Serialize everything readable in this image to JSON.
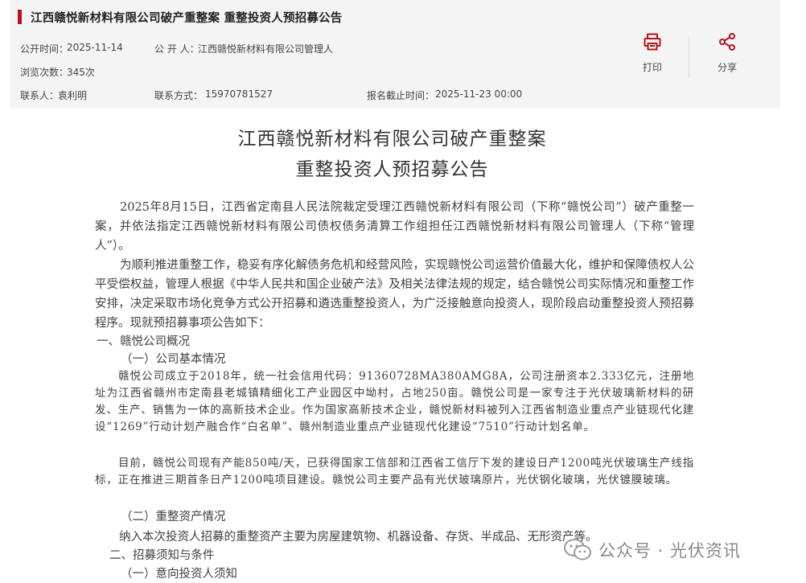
{
  "header": {
    "title": "江西赣悦新材料有限公司破产重整案 重整投资人预招募公告",
    "publish_time_label": "公开时间：",
    "publish_time": "2025-11-14",
    "publisher_label": "公 开 人：",
    "publisher": "江西赣悦新材料有限公司管理人",
    "views_label": "浏览次数：",
    "views": "345次",
    "contact_label": "联系人：",
    "contact": "袁利明",
    "phone_label": "联系方式：",
    "phone": "15970781527",
    "deadline_label": "报名截止时间：",
    "deadline": "2025-11-23 00:00",
    "print_label": "打印",
    "share_label": "分享",
    "accent_color": "#b4141b",
    "print_icon": "printer-icon",
    "share_icon": "share-icon"
  },
  "article": {
    "title_line1": "江西赣悦新材料有限公司破产重整案",
    "title_line2": "重整投资人预招募公告",
    "para1": "2025年8月15日，江西省定南县人民法院裁定受理江西赣悦新材料有限公司（下称“赣悦公司”）破产重整一案，并依法指定江西赣悦新材料有限公司债权债务清算工作组担任江西赣悦新材料有限公司管理人（下称“管理人”）。",
    "para2": "为顺利推进重整工作，稳妥有序化解债务危机和经营风险，实现赣悦公司运营价值最大化，维护和保障债权人公平受偿权益，管理人根据《中华人民共和国企业破产法》及相关法律法规的规定，结合赣悦公司实际情况和重整工作安排，决定采取市场化竞争方式公开招募和遴选重整投资人，为广泛接触意向投资人，现阶段启动重整投资人预招募程序。现就预招募事项公告如下：",
    "section1": "一、赣悦公司概况",
    "section1_1": "（一）公司基本情况",
    "para3": "赣悦公司成立于2018年，统一社会信用代码：91360728MA380AMG8A，公司注册资本2.333亿元，注册地址为江西省赣州市定南县老城镇精细化工产业园区中坳村，占地250亩。赣悦公司是一家专注于光伏玻璃新材料的研发、生产、销售为一体的高新技术企业。作为国家高新技术企业，赣悦新材料被列入江西省制造业重点产业链现代化建设“1269”行动计划产融合作“白名单”、赣州制造业重点产业链现代化建设“7510”行动计划名单。",
    "para4": "目前，赣悦公司现有产能850吨/天，已获得国家工信部和江西省工信厅下发的建设日产1200吨光伏玻璃生产线指标，正在推进三期首条日产1200吨项目建设。赣悦公司主要产品有光伏玻璃原片，光伏钢化玻璃，光伏镀膜玻璃。",
    "section1_2": "（二）重整资产情况",
    "para5": "纳入本次投资人招募的重整资产主要为房屋建筑物、机器设备、存货、半成品、无形资产等。",
    "section2": "二、招募须知与条件",
    "section2_1": "（一）意向投资人须知"
  },
  "watermark": {
    "text": "公众号 · 光伏资讯",
    "icon": "wechat-icon"
  }
}
